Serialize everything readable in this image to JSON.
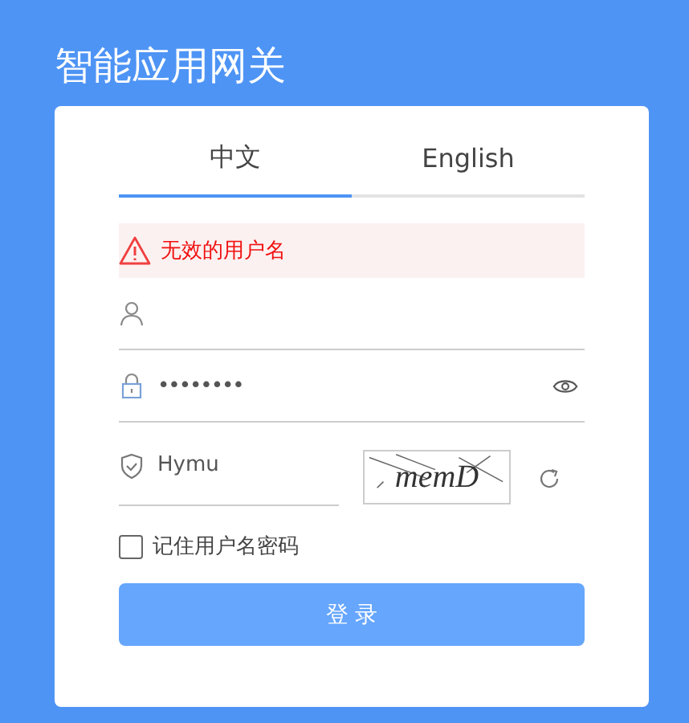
{
  "title": "智能应用网关",
  "tabs": [
    {
      "label": "中文",
      "selected": true
    },
    {
      "label": "English",
      "selected": false
    }
  ],
  "error": {
    "message": "无效的用户名"
  },
  "password": {
    "value": "••••••••"
  },
  "captcha": {
    "value": "Hymu",
    "code": "memD"
  },
  "remember": {
    "label": "记住用户名密码",
    "checked": false
  },
  "login_button": "登 录"
}
